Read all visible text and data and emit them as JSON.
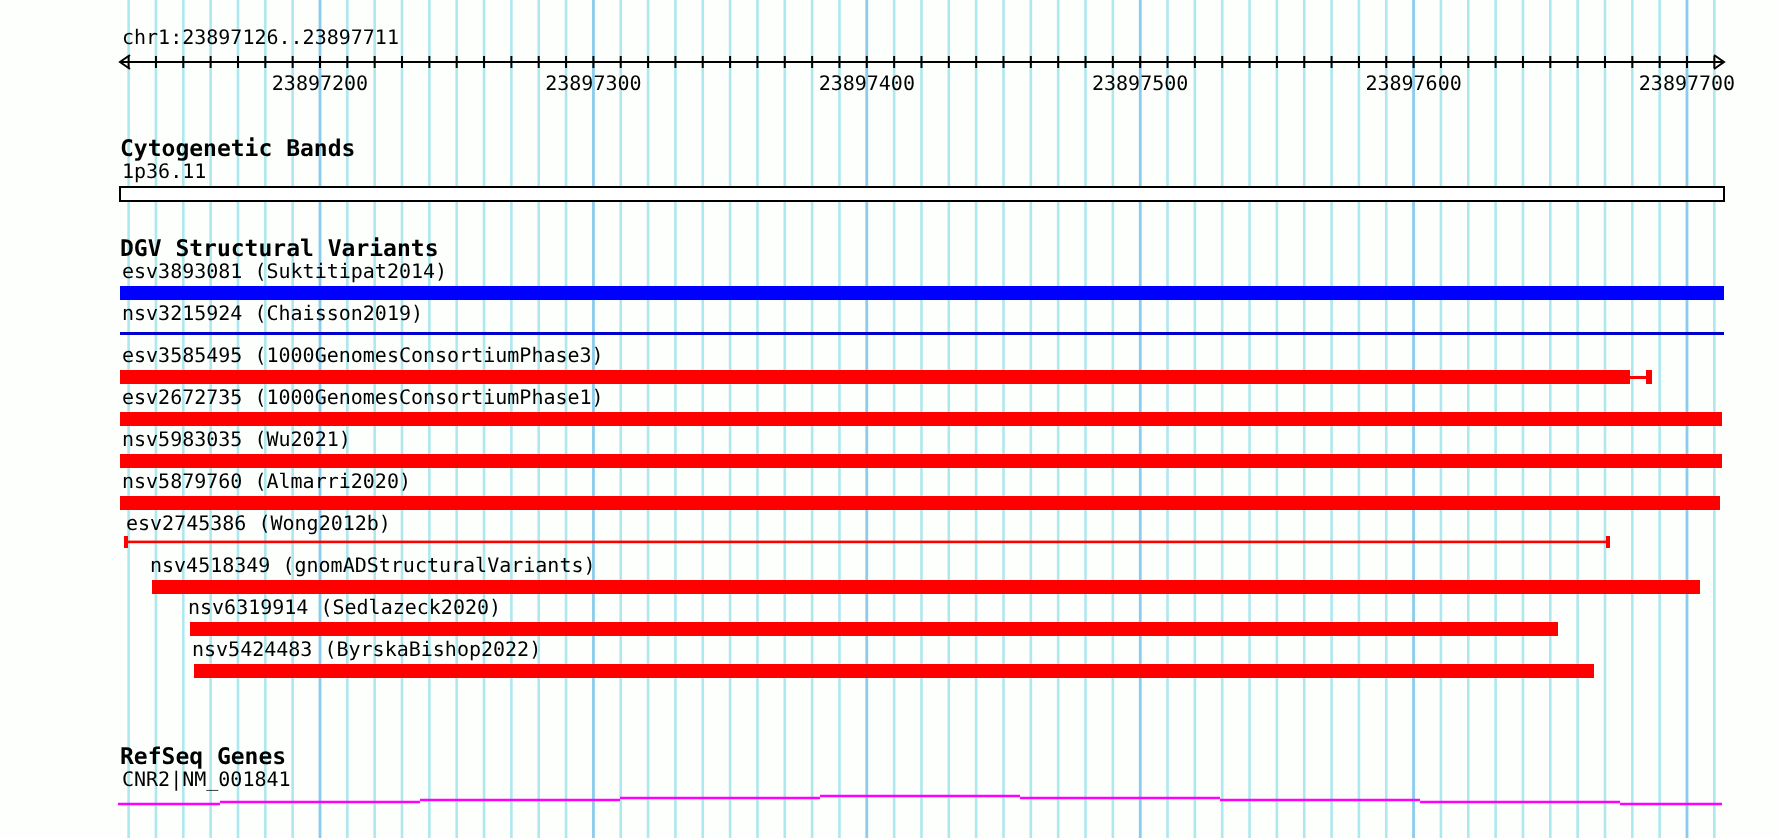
{
  "location": "chr1:23897126..23897711",
  "ruler": {
    "ticks": [
      "23897200",
      "23897300",
      "23897400",
      "23897500",
      "23897600",
      "23897700"
    ]
  },
  "tracks": [
    {
      "title": "Cytogenetic Bands",
      "kind": "cytoband",
      "features": [
        {
          "label": "1p36.11"
        }
      ]
    },
    {
      "title": "DGV Structural Variants",
      "kind": "variants",
      "features": [
        {
          "label": "esv3893081 (Suktitipat2014)",
          "kind": "thick",
          "color": "#0000ff"
        },
        {
          "label": "nsv3215924 (Chaisson2019)",
          "kind": "line",
          "color": "#0000cc"
        },
        {
          "label": "esv3585495 (1000GenomesConsortiumPhase3)",
          "kind": "thick-tail",
          "color": "#ff0000"
        },
        {
          "label": "esv2672735 (1000GenomesConsortiumPhase1)",
          "kind": "thick",
          "color": "#ff0000"
        },
        {
          "label": "nsv5983035 (Wu2021)",
          "kind": "thick",
          "color": "#ff0000"
        },
        {
          "label": "nsv5879760 (Almarri2020)",
          "kind": "thick",
          "color": "#ff0000"
        },
        {
          "label": "esv2745386 (Wong2012b)",
          "kind": "line-capped",
          "color": "#ff0000"
        },
        {
          "label": "nsv4518349 (gnomADStructuralVariants)",
          "kind": "thick",
          "color": "#ff0000"
        },
        {
          "label": "nsv6319914 (Sedlazeck2020)",
          "kind": "thick",
          "color": "#ff0000"
        },
        {
          "label": "nsv5424483 (ByrskaBishop2022)",
          "kind": "thick",
          "color": "#ff0000"
        }
      ]
    },
    {
      "title": "RefSeq Genes",
      "kind": "gene",
      "features": [
        {
          "label": "CNR2|NM_001841"
        }
      ]
    }
  ]
}
